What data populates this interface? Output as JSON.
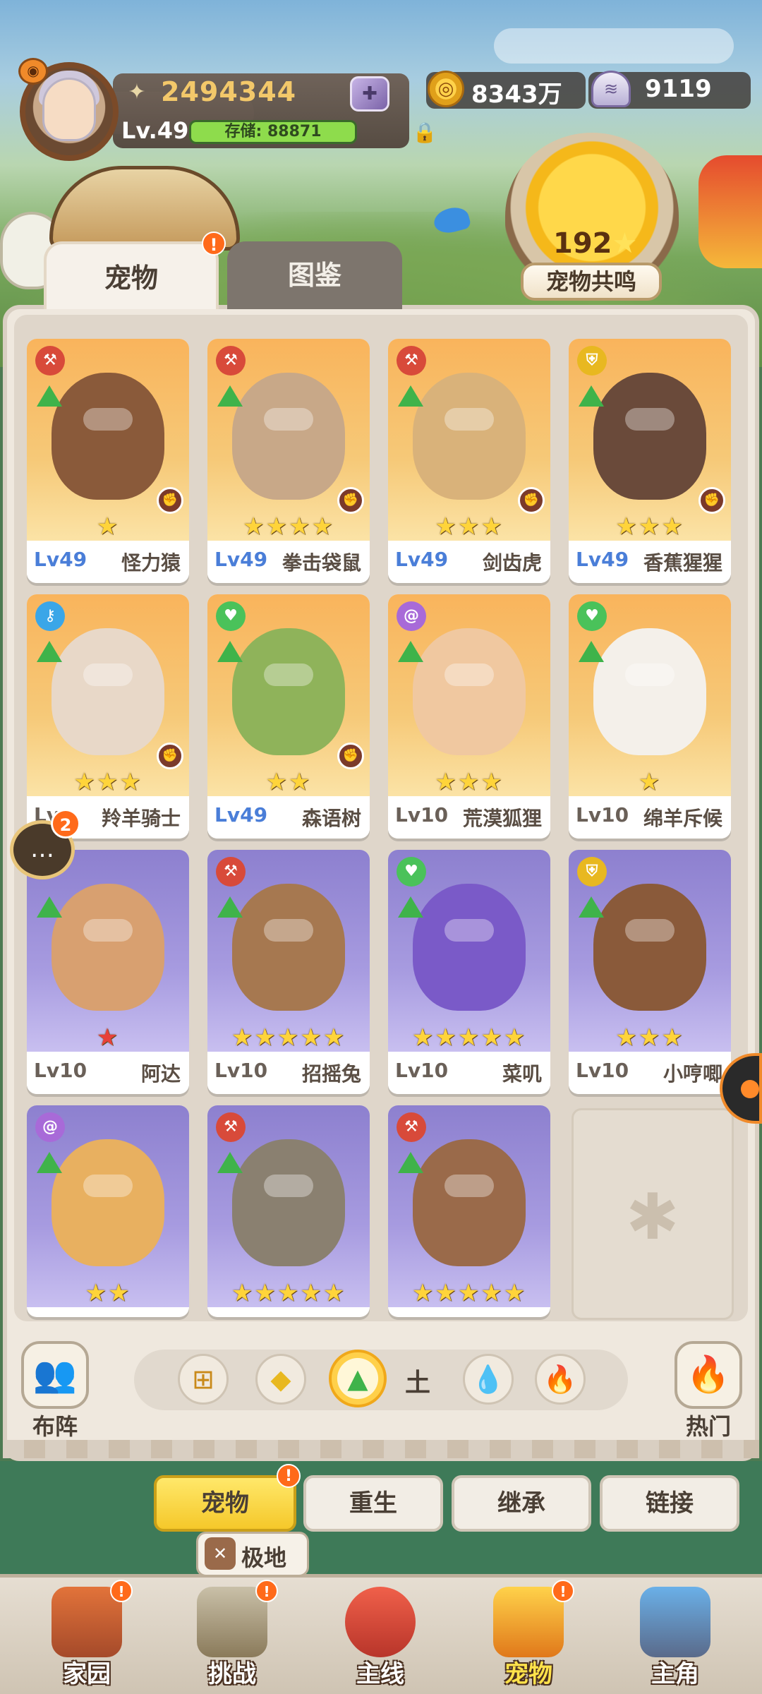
{
  "player": {
    "power": "2494344",
    "level": "Lv.49",
    "storage": "存储: 88871",
    "gold": "8343万",
    "shells": "9119"
  },
  "resonance": {
    "value": "192",
    "label": "宠物共鸣"
  },
  "tabs": {
    "pet": "宠物",
    "dex": "图鉴",
    "pet_badge": "!"
  },
  "pets": [
    {
      "level": "Lv49",
      "name": "怪力猿",
      "stars": "★",
      "element": "axe-icon",
      "bg": "orange"
    },
    {
      "level": "Lv49",
      "name": "拳击袋鼠",
      "stars": "★★★★",
      "element": "axe-icon",
      "bg": "orange"
    },
    {
      "level": "Lv49",
      "name": "剑齿虎",
      "stars": "★★★",
      "element": "axe-icon",
      "bg": "orange"
    },
    {
      "level": "Lv49",
      "name": "香蕉猩猩",
      "stars": "★★★",
      "element": "shield-icon",
      "bg": "orange"
    },
    {
      "level": "Lv",
      "name": "羚羊骑士",
      "stars": "★★★",
      "element": "key-icon",
      "bg": "orange"
    },
    {
      "level": "Lv49",
      "name": "森语树",
      "stars": "★★",
      "element": "heart-icon",
      "bg": "orange"
    },
    {
      "level": "Lv10",
      "name": "荒漠狐狸",
      "stars": "★★★",
      "element": "spiral-icon",
      "bg": "orange"
    },
    {
      "level": "Lv10",
      "name": "绵羊斥候",
      "stars": "★",
      "element": "heart-icon",
      "bg": "orange"
    },
    {
      "level": "Lv10",
      "name": "阿达",
      "stars": "★",
      "element": "",
      "bg": "purple"
    },
    {
      "level": "Lv10",
      "name": "招摇兔",
      "stars": "★★★★★",
      "element": "axe-icon",
      "bg": "purple"
    },
    {
      "level": "Lv10",
      "name": "菜叽",
      "stars": "★★★★★",
      "element": "heart-icon",
      "bg": "purple"
    },
    {
      "level": "Lv10",
      "name": "小哼唧",
      "stars": "★★★",
      "element": "shield-icon",
      "bg": "purple"
    },
    {
      "level": "",
      "name": "",
      "stars": "★★",
      "element": "spiral-icon",
      "bg": "purple"
    },
    {
      "level": "",
      "name": "",
      "stars": "★★★★★",
      "element": "axe-icon",
      "bg": "purple"
    },
    {
      "level": "",
      "name": "",
      "stars": "★★★★★",
      "element": "axe-icon",
      "bg": "purple"
    }
  ],
  "chat": {
    "badge": "2"
  },
  "filters": {
    "formation": "布阵",
    "hot": "热门",
    "earth": "土"
  },
  "subtabs": {
    "pet": "宠物",
    "rebirth": "重生",
    "inherit": "继承",
    "link": "链接",
    "badge": "!",
    "extreme": "极地"
  },
  "nav": {
    "home": "家园",
    "challenge": "挑战",
    "main": "主线",
    "pet": "宠物",
    "hero": "主角",
    "badge": "!"
  },
  "colors": {
    "orange_card": "#f9b45c",
    "purple_card": "#8d80cf",
    "level_blue": "#4a7ed8",
    "badge": "#ff6a1a"
  }
}
